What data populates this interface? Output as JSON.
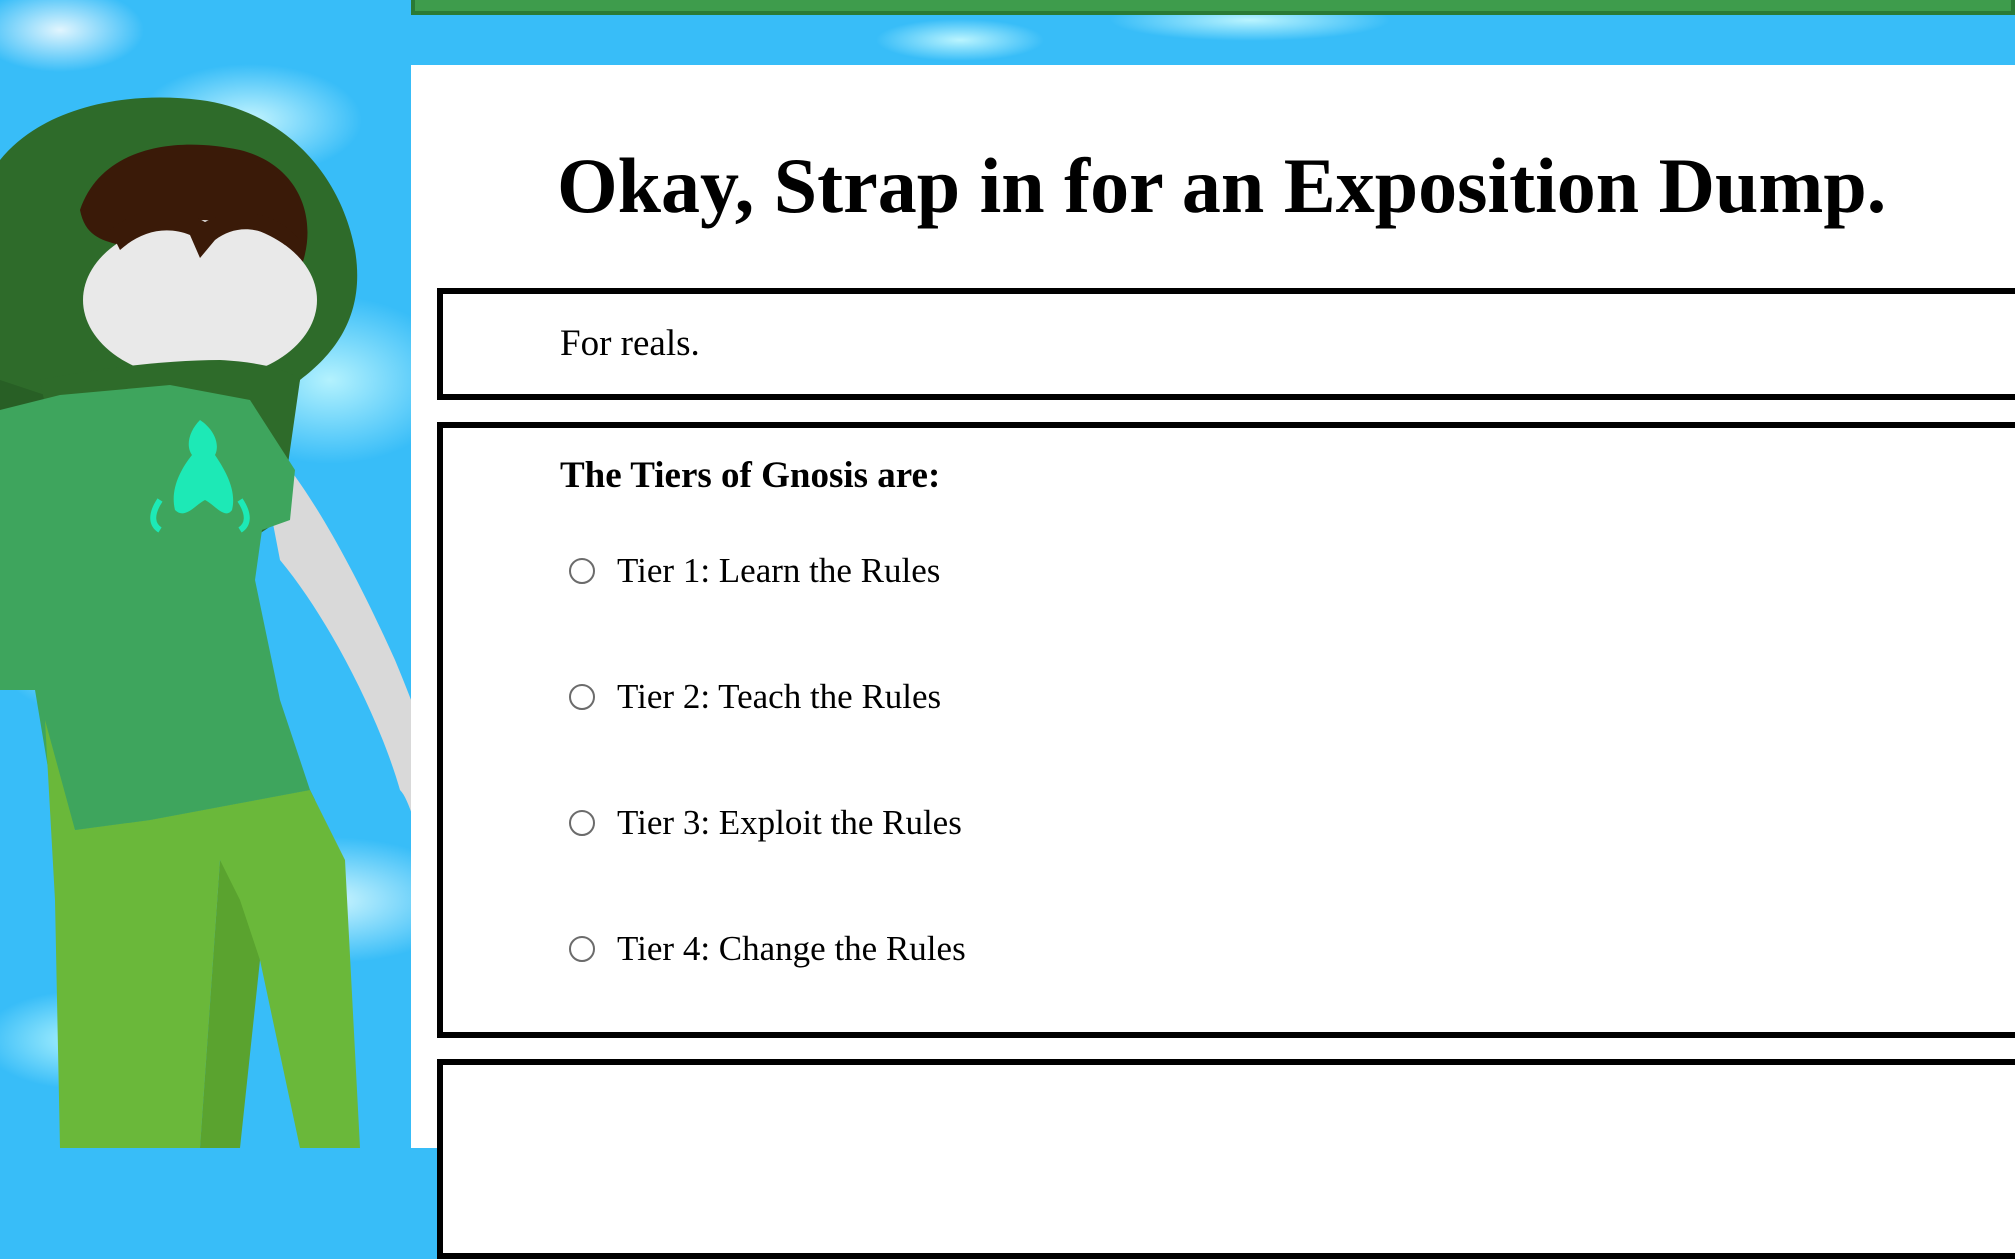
{
  "page": {
    "title": "Okay, Strap in for an Exposition Dump."
  },
  "intro_box": {
    "text": "For reals."
  },
  "tiers_box": {
    "heading": "The Tiers of Gnosis are:",
    "options": [
      {
        "label": "Tier 1: Learn the Rules",
        "selected": false
      },
      {
        "label": "Tier 2: Teach the Rules",
        "selected": false
      },
      {
        "label": "Tier 3: Exploit the Rules",
        "selected": false
      },
      {
        "label": "Tier 4: Change the Rules",
        "selected": false
      }
    ]
  },
  "colors": {
    "background_sky": "#38bdf8",
    "banner_green": "#3e9c4c",
    "panel": "#ffffff",
    "border": "#000000",
    "hood_green": "#2e6b2a",
    "shirt_green": "#3ea55d",
    "pants_green": "#6ab83a",
    "symbol_teal": "#1de9b6"
  }
}
